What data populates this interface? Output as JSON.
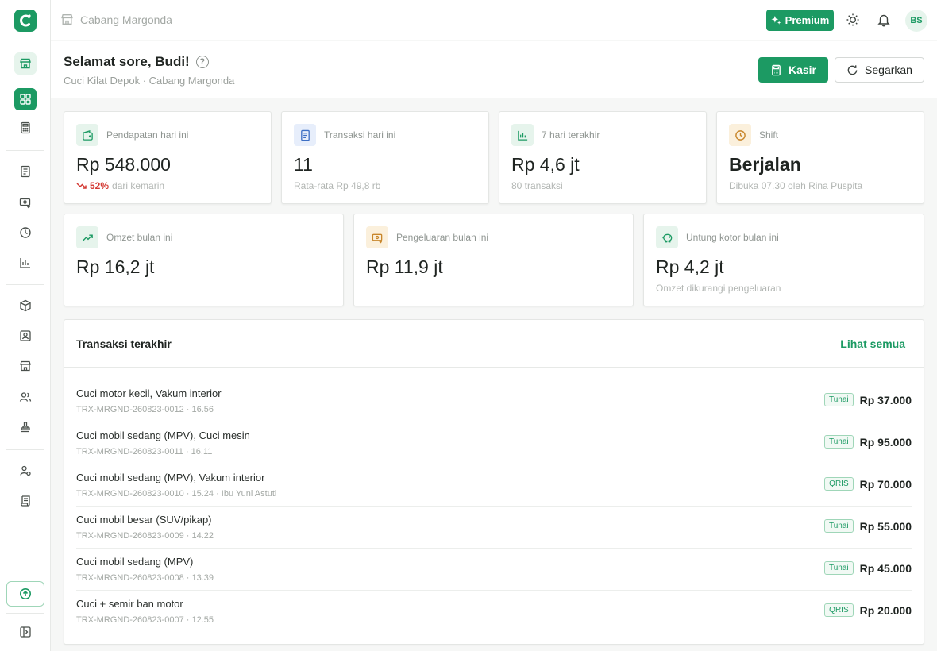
{
  "colors": {
    "accent": "#1c9a63",
    "danger": "#d43a34"
  },
  "topbar": {
    "branch": "Cabang Margonda",
    "premium_label": "Premium",
    "avatar_initials": "BS"
  },
  "header": {
    "greeting": "Selamat sore, Budi!",
    "subtitle": "Cuci Kilat Depok · Cabang Margonda",
    "kasir_label": "Kasir",
    "refresh_label": "Segarkan"
  },
  "stats": [
    {
      "label": "Pendapatan hari ini",
      "value": "Rp 548.000",
      "change": "52%",
      "sub": "dari kemarin",
      "icon": "wallet-icon"
    },
    {
      "label": "Transaksi hari ini",
      "value": "11",
      "sub": "Rata-rata Rp 49,8 rb",
      "icon": "receipt-icon"
    },
    {
      "label": "7 hari terakhir",
      "value": "Rp 4,6 jt",
      "sub": "80 transaksi",
      "icon": "bar-chart-icon"
    },
    {
      "label": "Shift",
      "value": "Berjalan",
      "sub": "Dibuka 07.30 oleh Rina Puspita",
      "icon": "clock-icon"
    },
    {
      "label": "Omzet bulan ini",
      "value": "Rp 16,2 jt",
      "icon": "trend-up-icon"
    },
    {
      "label": "Pengeluaran bulan ini",
      "value": "Rp 11,9 jt",
      "icon": "cash-out-icon"
    },
    {
      "label": "Untung kotor bulan ini",
      "value": "Rp 4,2 jt",
      "sub": "Omzet dikurangi pengeluaran",
      "icon": "piggy-bank-icon"
    }
  ],
  "transactions": {
    "title": "Transaksi terakhir",
    "see_all": "Lihat semua",
    "rows": [
      {
        "name": "Cuci motor kecil, Vakum interior",
        "meta": "TRX-MRGND-260823-0012 · 16.56",
        "method": "Tunai",
        "amount": "Rp 37.000"
      },
      {
        "name": "Cuci mobil sedang (MPV), Cuci mesin",
        "meta": "TRX-MRGND-260823-0011 · 16.11",
        "method": "Tunai",
        "amount": "Rp 95.000"
      },
      {
        "name": "Cuci mobil sedang (MPV), Vakum interior",
        "meta": "TRX-MRGND-260823-0010 · 15.24 · Ibu Yuni Astuti",
        "method": "QRIS",
        "amount": "Rp 70.000"
      },
      {
        "name": "Cuci mobil besar (SUV/pikap)",
        "meta": "TRX-MRGND-260823-0009 · 14.22",
        "method": "Tunai",
        "amount": "Rp 55.000"
      },
      {
        "name": "Cuci mobil sedang (MPV)",
        "meta": "TRX-MRGND-260823-0008 · 13.39",
        "method": "Tunai",
        "amount": "Rp 45.000"
      },
      {
        "name": "Cuci + semir ban motor",
        "meta": "TRX-MRGND-260823-0007 · 12.55",
        "method": "QRIS",
        "amount": "Rp 20.000"
      }
    ]
  }
}
